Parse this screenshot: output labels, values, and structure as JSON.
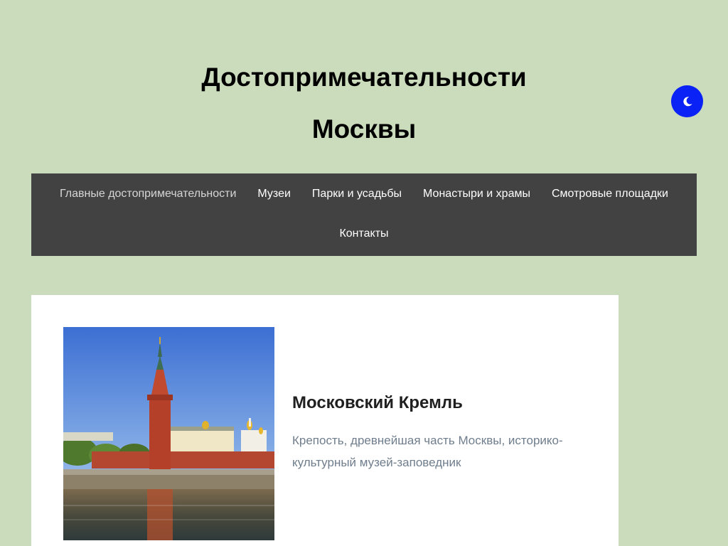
{
  "site": {
    "title_line1": "Достопримечательности",
    "title_line2": "Москвы"
  },
  "theme_toggle": {
    "icon": "moon-icon",
    "color": "#0a22f5"
  },
  "nav": {
    "items": [
      {
        "label": "Главные достопримечательности",
        "active": true
      },
      {
        "label": "Музеи"
      },
      {
        "label": "Парки и усадьбы"
      },
      {
        "label": "Монастыри и храмы"
      },
      {
        "label": "Смотровые площадки"
      },
      {
        "label": "Контакты"
      }
    ]
  },
  "post": {
    "title": "Московский Кремль",
    "excerpt": "Крепость, древнейшая часть Москвы, историко-культурный музей-заповедник"
  },
  "colors": {
    "page_bg": "#cbdcbd",
    "nav_bg": "#424242",
    "card_bg": "#ffffff",
    "excerpt_text": "#6f7d8c"
  }
}
